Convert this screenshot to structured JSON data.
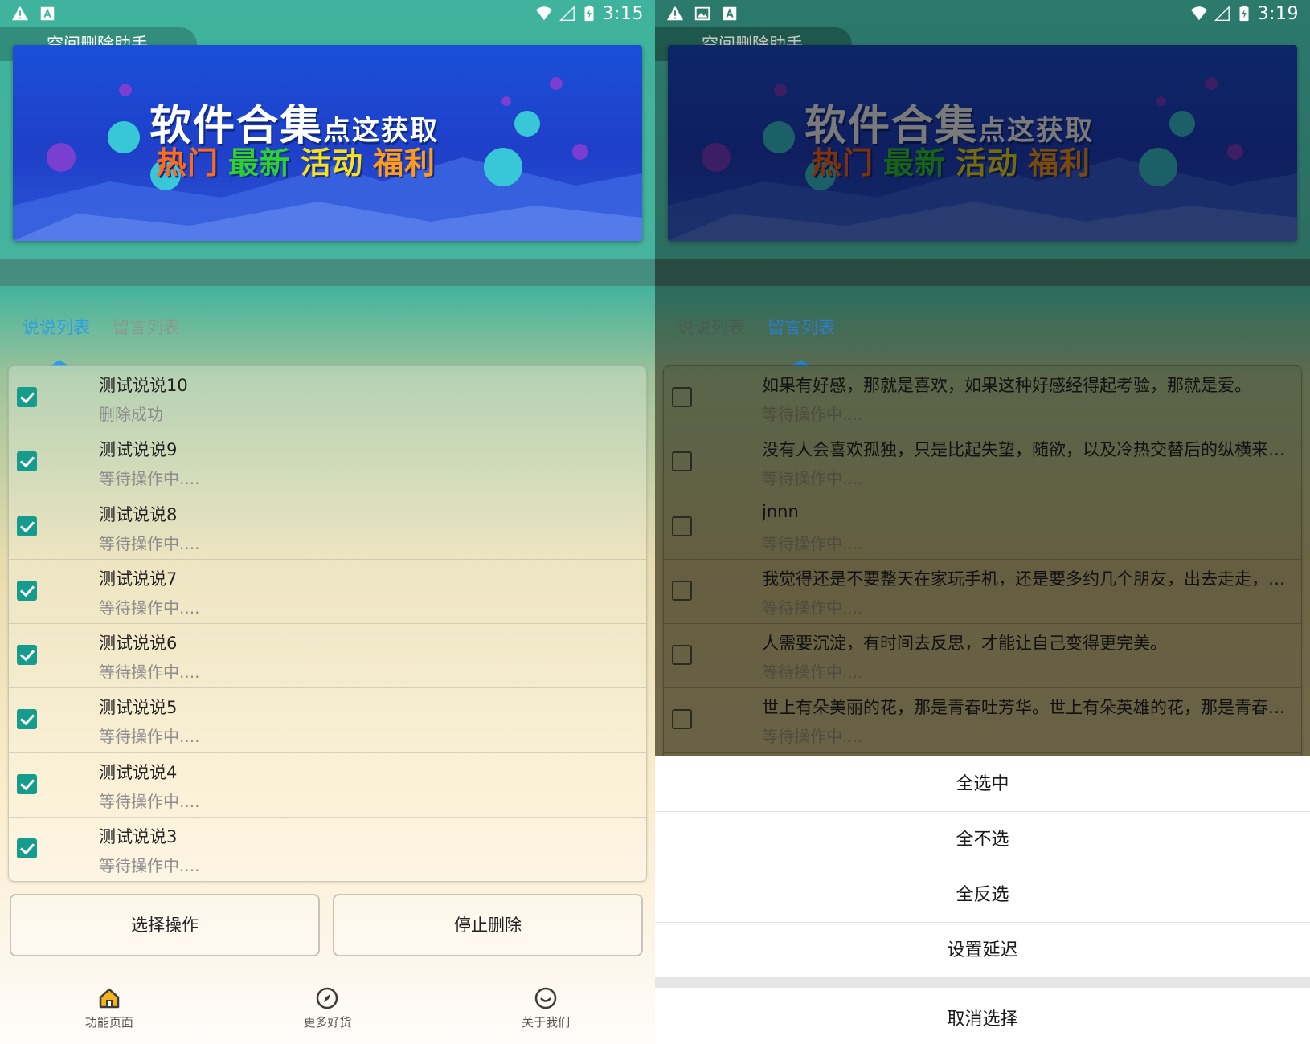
{
  "left": {
    "status": {
      "time": "3:15"
    },
    "app_title": "空间删除助手",
    "banner": {
      "line1_big": "软件合集",
      "line1_small": "点这获取",
      "words": [
        "热门",
        "最新",
        "活动",
        "福利"
      ]
    },
    "tabs": [
      {
        "label": "说说列表",
        "active": true
      },
      {
        "label": "留言列表",
        "active": false
      }
    ],
    "rows": [
      {
        "title": "测试说说10",
        "status": "删除成功",
        "checked": true
      },
      {
        "title": "测试说说9",
        "status": "等待操作中....",
        "checked": true
      },
      {
        "title": "测试说说8",
        "status": "等待操作中....",
        "checked": true
      },
      {
        "title": "测试说说7",
        "status": "等待操作中....",
        "checked": true
      },
      {
        "title": "测试说说6",
        "status": "等待操作中....",
        "checked": true
      },
      {
        "title": "测试说说5",
        "status": "等待操作中....",
        "checked": true
      },
      {
        "title": "测试说说4",
        "status": "等待操作中....",
        "checked": true
      },
      {
        "title": "测试说说3",
        "status": "等待操作中....",
        "checked": true
      }
    ],
    "buttons": {
      "select": "选择操作",
      "stop": "停止删除"
    },
    "nav": [
      {
        "label": "功能页面",
        "icon": "home-icon"
      },
      {
        "label": "更多好货",
        "icon": "compass-icon"
      },
      {
        "label": "关于我们",
        "icon": "smiley-icon"
      }
    ]
  },
  "right": {
    "status": {
      "time": "3:19"
    },
    "app_title": "空间删除助手",
    "banner": {
      "line1_big": "软件合集",
      "line1_small": "点这获取",
      "words": [
        "热门",
        "最新",
        "活动",
        "福利"
      ]
    },
    "tabs": [
      {
        "label": "说说列表",
        "active": false
      },
      {
        "label": "留言列表",
        "active": true
      }
    ],
    "rows": [
      {
        "title": "如果有好感，那就是喜欢，如果这种好感经得起考验，那就是爱。",
        "status": "等待操作中....",
        "checked": false
      },
      {
        "title": "没有人会喜欢孤独，只是比起失望，随欲，以及冷热交替后的纵横来说...",
        "status": "等待操作中....",
        "checked": false
      },
      {
        "title": "jnnn",
        "status": "等待操作中....",
        "checked": false
      },
      {
        "title": "我觉得还是不要整天在家玩手机，还是要多约几个朋友，出去走走，然...",
        "status": "等待操作中....",
        "checked": false
      },
      {
        "title": "人需要沉淀，有时间去反思，才能让自己变得更完美。",
        "status": "等待操作中....",
        "checked": false
      },
      {
        "title": "世上有朵美丽的花，那是青春吐芳华。世上有朵英雄的花，那是青春放...",
        "status": "等待操作中....",
        "checked": false
      }
    ],
    "sheet": {
      "items": [
        "全选中",
        "全不选",
        "全反选",
        "设置延迟"
      ],
      "cancel": "取消选择"
    }
  },
  "colors": {
    "accent_teal": "#159c8c",
    "tab_active_blue": "#2b9ee8",
    "banner_blue": "#1f3fc8"
  }
}
